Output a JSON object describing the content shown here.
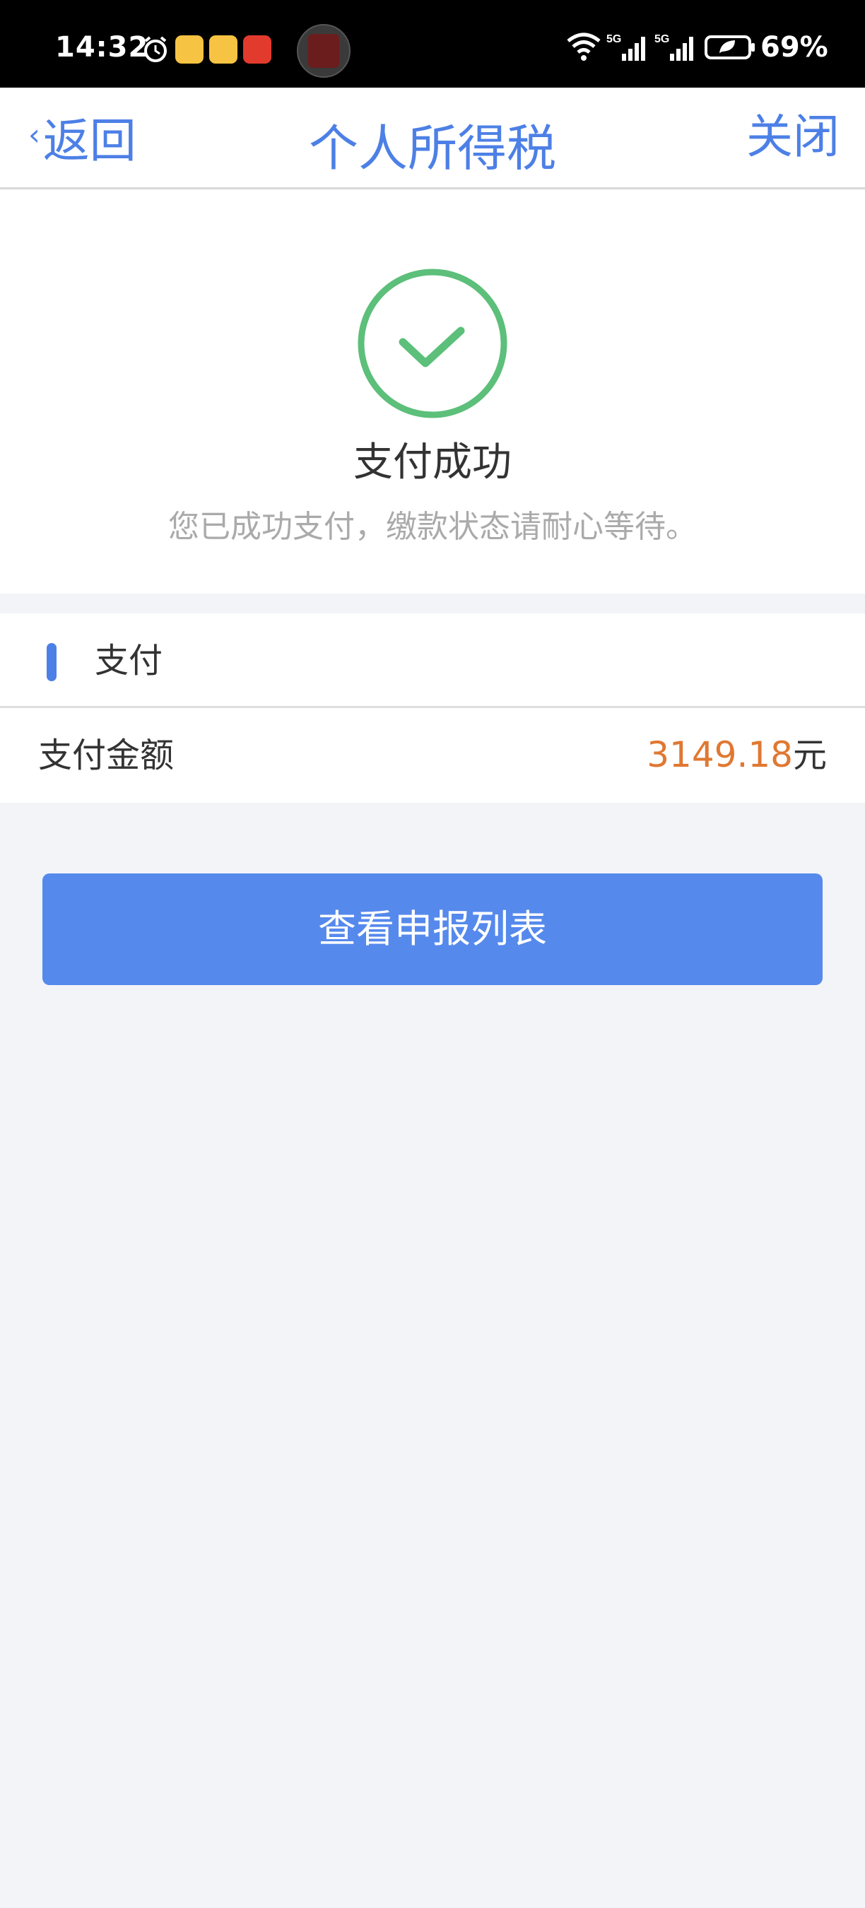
{
  "status_bar": {
    "time": "14:32",
    "battery": "69%",
    "icons": [
      "alarm-icon",
      "weibo-icon",
      "weibo-icon",
      "pay-app-icon",
      "avatar-icon",
      "wifi-icon",
      "signal-5g-icon",
      "signal-5g-icon",
      "battery-icon"
    ]
  },
  "nav": {
    "back_label": "返回",
    "back_icon": "chevron-left-icon",
    "title": "个人所得税",
    "close_label": "关闭"
  },
  "result": {
    "icon": "check-circle-icon",
    "title": "支付成功",
    "description": "您已成功支付，缴款状态请耐心等待。"
  },
  "payment": {
    "section_title": "支付",
    "amount_label": "支付金额",
    "amount_value": "3149.18",
    "amount_unit": "元"
  },
  "actions": {
    "view_list_label": "查看申报列表"
  },
  "colors": {
    "accent": "#4d80e6",
    "button": "#5689ec",
    "success": "#5cbf7a",
    "amount": "#e07832",
    "page_bg": "#f2f4f8"
  }
}
